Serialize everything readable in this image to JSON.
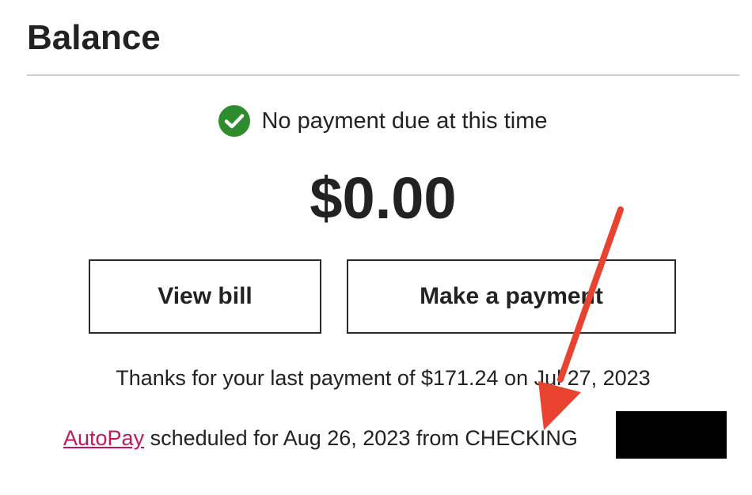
{
  "header": {
    "title": "Balance"
  },
  "status": {
    "icon": "check-circle-icon",
    "icon_color": "#2e8b2e",
    "text": "No payment due at this time"
  },
  "balance": {
    "amount": "$0.00"
  },
  "actions": {
    "view_bill_label": "View bill",
    "make_payment_label": "Make a payment"
  },
  "last_payment": {
    "text": "Thanks for your last payment of $171.24 on Jul 27, 2023"
  },
  "autopay": {
    "link_label": "AutoPay",
    "link_color": "#c2185b",
    "text": " scheduled for Aug 26, 2023 from CHECKING"
  },
  "annotation": {
    "arrow_color": "#e8432f"
  }
}
